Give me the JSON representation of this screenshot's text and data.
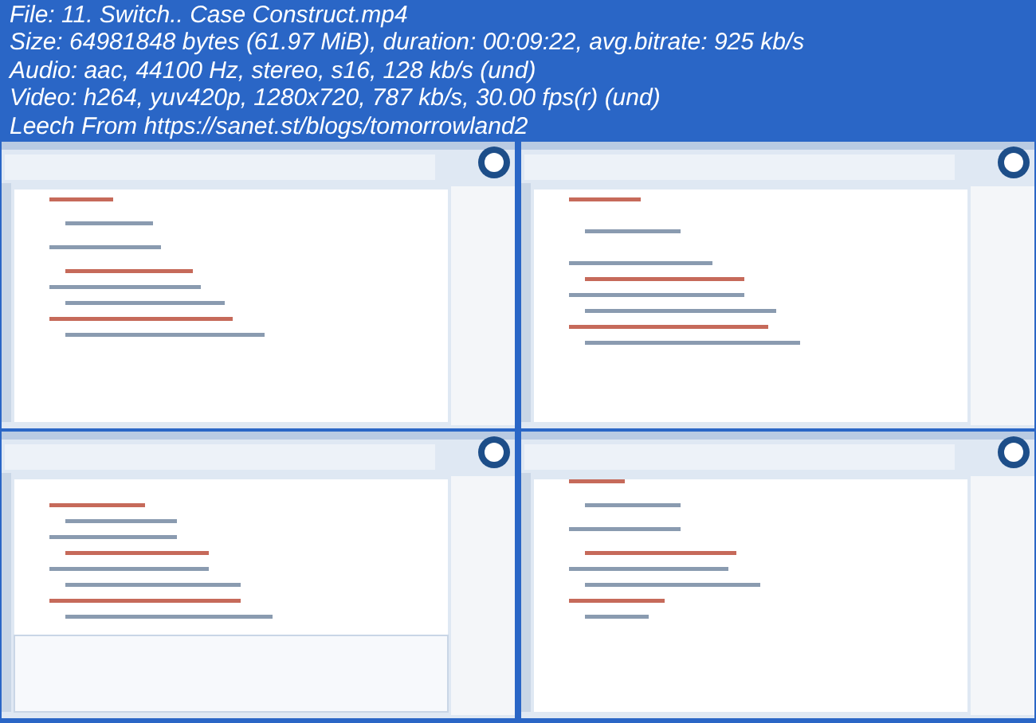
{
  "header_lines": [
    "File: 11. Switch.. Case Construct.mp4",
    "Size: 64981848 bytes (61.97 MiB), duration: 00:09:22, avg.bitrate: 925 kb/s",
    "Audio: aac, 44100 Hz, stereo, s16, 128 kb/s (und)",
    "Video: h264, yuv420p, 1280x720, 787 kb/s, 30.00 fps(r) (und)",
    "Leech From https://sanet.st/blogs/tomorrowland2"
  ]
}
